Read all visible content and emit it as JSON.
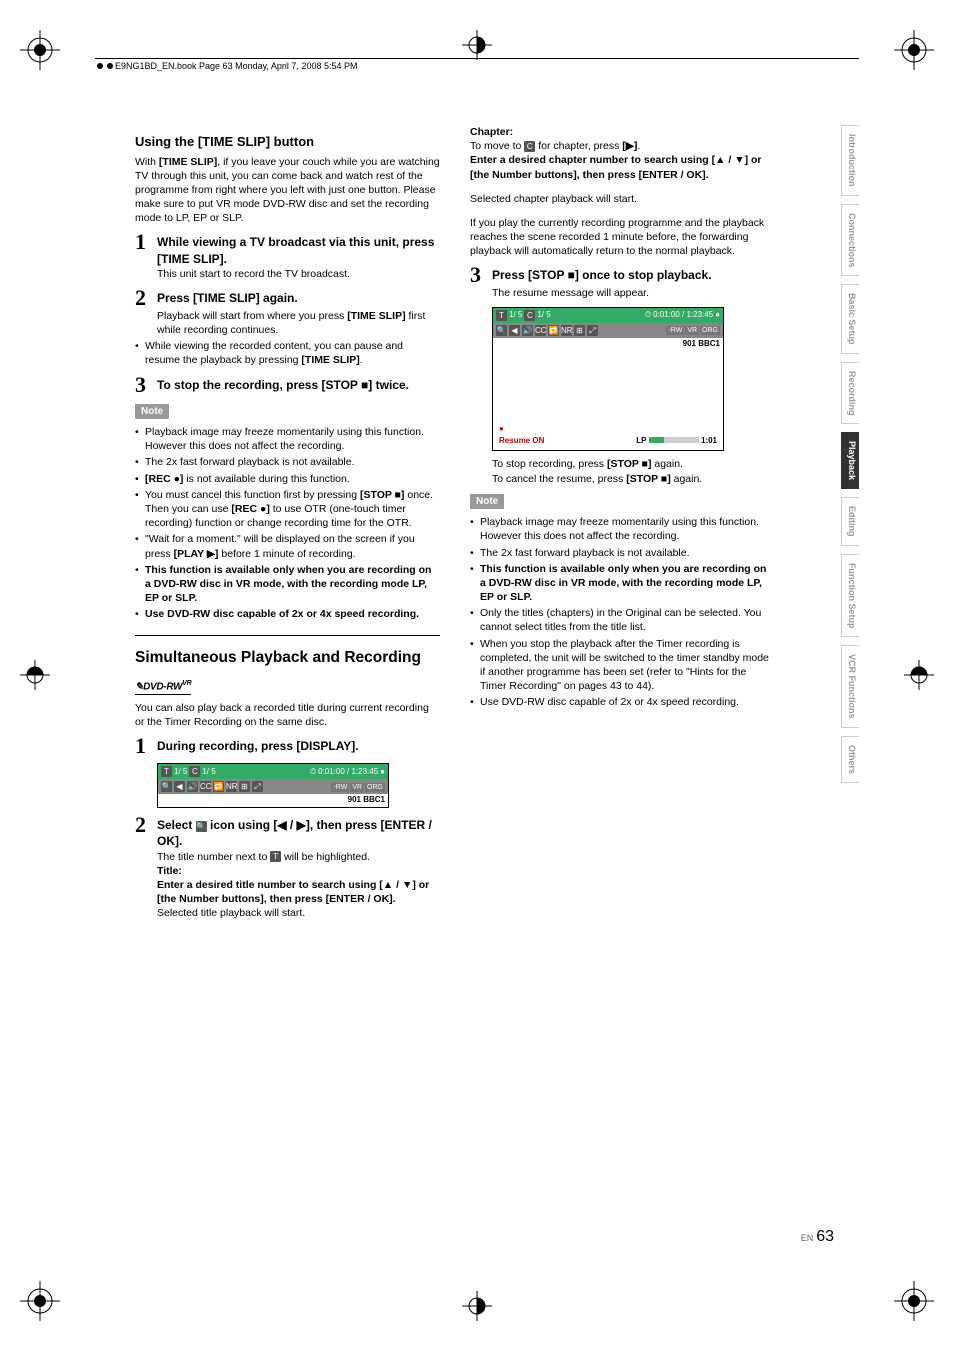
{
  "header": {
    "text": "E9NG1BD_EN.book  Page 63  Monday, April 7, 2008  5:54 PM"
  },
  "left_col": {
    "h_using": "Using the [TIME SLIP] button",
    "intro": "With [TIME SLIP], if you leave your couch while you are watching TV through this unit, you can come back and watch rest of the programme from right where you left with just one button. Please make sure to put VR mode DVD-RW disc and set the recording mode to LP, EP or SLP.",
    "step1": "While viewing a TV broadcast via this unit, press [TIME SLIP].",
    "step1_body": "This unit start to record the TV broadcast.",
    "step2": "Press [TIME SLIP] again.",
    "step2_body1": "Playback will start from where you press [TIME SLIP] first while recording continues.",
    "step2_bul": "While viewing the recorded content, you can pause and resume the playback by pressing [TIME SLIP].",
    "step3": "To stop the recording, press [STOP ■] twice.",
    "note_label": "Note",
    "note1": "Playback image may freeze momentarily using this function. However this does not affect the recording.",
    "note2": "The 2x fast forward playback is not available.",
    "note3": "[REC ●] is not available during this function.",
    "note4": "You must cancel this function first by pressing [STOP ■] once. Then you can use [REC ●] to use OTR (one-touch timer recording) function or change recording time for the OTR.",
    "note5": "\"Wait for a moment.\" will be displayed on the screen if you press [PLAY ▶] before 1 minute of recording.",
    "note6": "This function is available only when you are recording on a DVD-RW disc in VR mode, with the recording mode LP, EP or SLP.",
    "note7": "Use DVD-RW disc capable of 2x or 4x speed recording.",
    "h_simul": "Simultaneous Playback and Recording",
    "dvdrw": "DVD-RW",
    "dvdrw_sup": "VR",
    "simul_intro": "You can also play back a recorded title during current recording or the Timer Recording on the same disc.",
    "s_step1": "During recording, press [DISPLAY].",
    "s_step2": "Select        icon using [◀ / ▶], then press [ENTER / OK].",
    "s_step2_body": "The title number next to     will be highlighted.",
    "title_label": "Title:",
    "title_body": "Enter a desired title number to search using [▲ / ▼] or [the Number buttons], then press [ENTER / OK].",
    "title_after": "Selected title playback will start."
  },
  "right_col": {
    "chapter_label": "Chapter:",
    "chapter_line1": "To move to     for chapter, press [▶].",
    "chapter_body": "Enter a desired chapter number to search using [▲ / ▼] or [the Number buttons], then press [ENTER / OK].",
    "chapter_after": "Selected chapter playback will start.",
    "para1": "If you play the currently recording programme and the playback reaches the scene recorded 1 minute before, the forwarding playback will automatically return to the normal playback.",
    "r_step3": "Press [STOP ■] once to stop playback.",
    "r_step3_body": "The resume message will appear.",
    "after_osd1": "To stop recording, press [STOP ■] again.",
    "after_osd2": "To cancel the resume, press [STOP ■] again.",
    "note_label": "Note",
    "rn1": "Playback image may freeze momentarily using this function. However this does not affect the recording.",
    "rn2": "The 2x fast forward playback is not available.",
    "rn3": "This function is available only when you are recording on a DVD-RW disc in VR mode, with the recording mode LP, EP or SLP.",
    "rn4": "Only the titles (chapters) in the Original can be selected. You cannot select titles from the title list.",
    "rn5": "When you stop the playback after the Timer recording is completed, the unit will be switched to the timer standby mode if another programme has been set (refer to \"Hints for the Timer Recording\" on pages 43 to 44).",
    "rn6": "Use DVD-RW disc capable of 2x or 4x speed recording."
  },
  "osd": {
    "title_count": "1/  5",
    "chap_count": "1/  5",
    "time": "0:01:00 / 1:23:45",
    "tags": [
      "-RW",
      "VR",
      "ORG"
    ],
    "channel": "901 BBC1",
    "resume": "Resume ON",
    "lp": "LP",
    "elapsed": "1:01"
  },
  "tabs": [
    "Introduction",
    "Connections",
    "Basic Setup",
    "Recording",
    "Playback",
    "Editing",
    "Function Setup",
    "VCR Functions",
    "Others"
  ],
  "active_tab": "Playback",
  "page_en": "EN",
  "page_num": "63"
}
